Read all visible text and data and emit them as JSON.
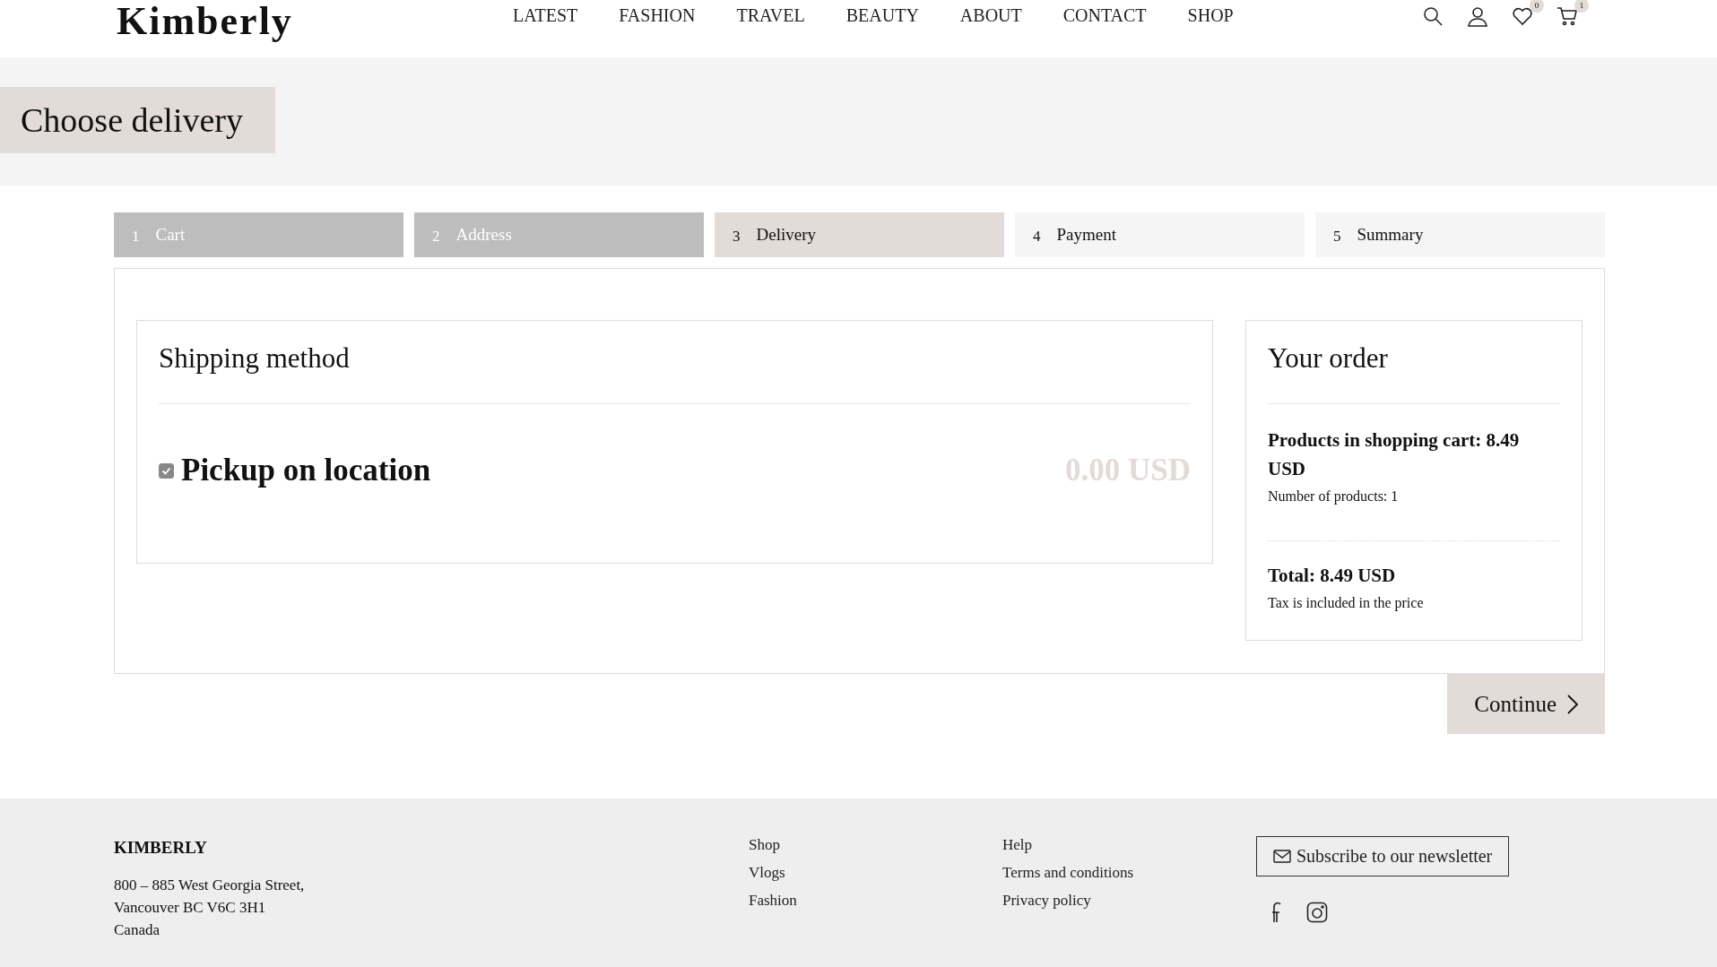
{
  "header": {
    "logo": "Kimberly",
    "nav": [
      "LATEST",
      "FASHION",
      "TRAVEL",
      "BEAUTY",
      "ABOUT",
      "CONTACT",
      "SHOP"
    ],
    "wishlist_count": "0",
    "cart_count": "1"
  },
  "page_title": "Choose delivery",
  "steps": [
    {
      "number": "1",
      "label": "Cart",
      "completed": true,
      "selected": false
    },
    {
      "number": "2",
      "label": "Address",
      "completed": true,
      "selected": false
    },
    {
      "number": "3",
      "label": "Delivery",
      "completed": false,
      "selected": true
    },
    {
      "number": "4",
      "label": "Payment",
      "completed": false,
      "selected": false
    },
    {
      "number": "5",
      "label": "Summary",
      "completed": false,
      "selected": false
    }
  ],
  "shipping": {
    "title": "Shipping method",
    "options": [
      {
        "label": "Pickup on location",
        "price": "0.00 USD",
        "checked": true
      }
    ]
  },
  "order": {
    "title": "Your order",
    "products": "Products in shopping cart: 8.49 USD",
    "count": "Number of products: 1",
    "total": "Total: 8.49 USD",
    "tax_note": "Tax is included in the price"
  },
  "continue_button": "Continue",
  "footer": {
    "brand": "KIMBERLY",
    "address": [
      "800 – 885 West Georgia Street,",
      "Vancouver BC V6C 3H1",
      "Canada"
    ],
    "links_1": [
      "Shop",
      "Vlogs",
      "Fashion"
    ],
    "links_2": [
      "Help",
      "Terms and conditions",
      "Privacy policy"
    ],
    "newsletter": "Subscribe to our newsletter"
  }
}
